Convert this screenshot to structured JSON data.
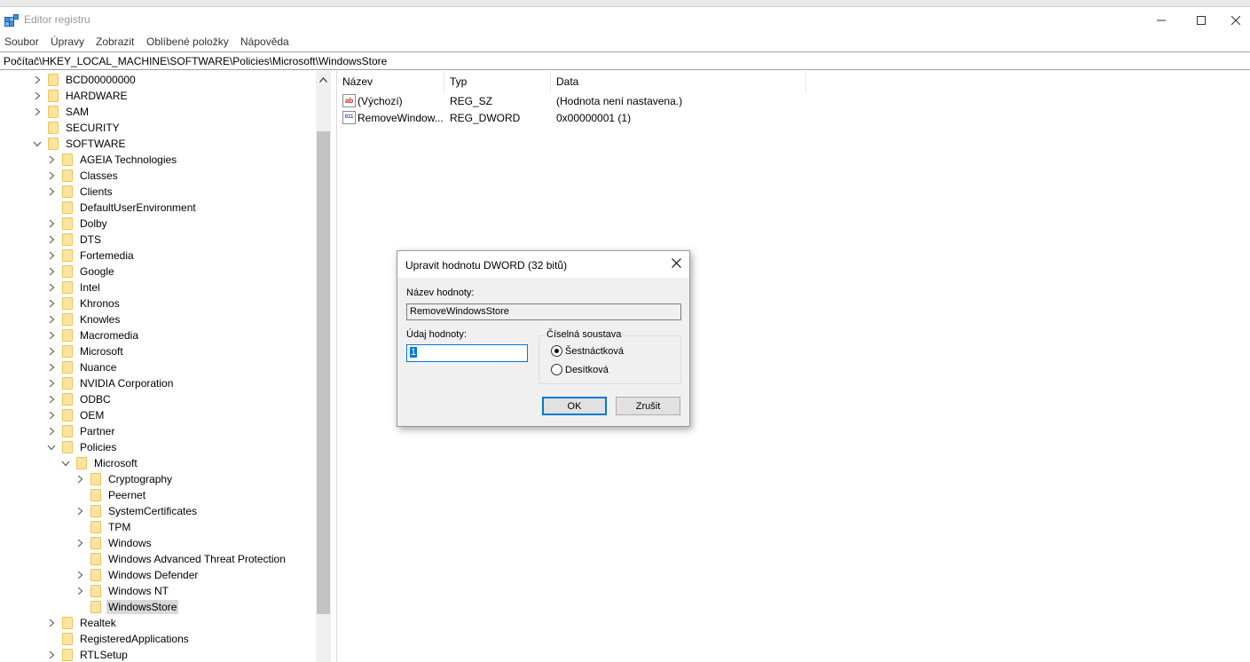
{
  "window": {
    "title": "Editor registru",
    "minimize_glyph": "—",
    "maximize_glyph": "☐",
    "close_glyph": "✕"
  },
  "menu": [
    "Soubor",
    "Úpravy",
    "Zobrazit",
    "Oblíbené položky",
    "Nápověda"
  ],
  "address": "Počítač\\HKEY_LOCAL_MACHINE\\SOFTWARE\\Policies\\Microsoft\\WindowsStore",
  "tree": [
    {
      "label": "BCD00000000",
      "level": 0,
      "expander": "collapsed"
    },
    {
      "label": "HARDWARE",
      "level": 0,
      "expander": "collapsed"
    },
    {
      "label": "SAM",
      "level": 0,
      "expander": "collapsed"
    },
    {
      "label": "SECURITY",
      "level": 0,
      "expander": "none"
    },
    {
      "label": "SOFTWARE",
      "level": 0,
      "expander": "expanded"
    },
    {
      "label": "AGEIA Technologies",
      "level": 1,
      "expander": "collapsed"
    },
    {
      "label": "Classes",
      "level": 1,
      "expander": "collapsed"
    },
    {
      "label": "Clients",
      "level": 1,
      "expander": "collapsed"
    },
    {
      "label": "DefaultUserEnvironment",
      "level": 1,
      "expander": "none"
    },
    {
      "label": "Dolby",
      "level": 1,
      "expander": "collapsed"
    },
    {
      "label": "DTS",
      "level": 1,
      "expander": "collapsed"
    },
    {
      "label": "Fortemedia",
      "level": 1,
      "expander": "collapsed"
    },
    {
      "label": "Google",
      "level": 1,
      "expander": "collapsed"
    },
    {
      "label": "Intel",
      "level": 1,
      "expander": "collapsed"
    },
    {
      "label": "Khronos",
      "level": 1,
      "expander": "collapsed"
    },
    {
      "label": "Knowles",
      "level": 1,
      "expander": "collapsed"
    },
    {
      "label": "Macromedia",
      "level": 1,
      "expander": "collapsed"
    },
    {
      "label": "Microsoft",
      "level": 1,
      "expander": "collapsed"
    },
    {
      "label": "Nuance",
      "level": 1,
      "expander": "collapsed"
    },
    {
      "label": "NVIDIA Corporation",
      "level": 1,
      "expander": "collapsed"
    },
    {
      "label": "ODBC",
      "level": 1,
      "expander": "collapsed"
    },
    {
      "label": "OEM",
      "level": 1,
      "expander": "collapsed"
    },
    {
      "label": "Partner",
      "level": 1,
      "expander": "collapsed"
    },
    {
      "label": "Policies",
      "level": 1,
      "expander": "expanded"
    },
    {
      "label": "Microsoft",
      "level": 2,
      "expander": "expanded"
    },
    {
      "label": "Cryptography",
      "level": 3,
      "expander": "collapsed"
    },
    {
      "label": "Peernet",
      "level": 3,
      "expander": "none"
    },
    {
      "label": "SystemCertificates",
      "level": 3,
      "expander": "collapsed"
    },
    {
      "label": "TPM",
      "level": 3,
      "expander": "none"
    },
    {
      "label": "Windows",
      "level": 3,
      "expander": "collapsed"
    },
    {
      "label": "Windows Advanced Threat Protection",
      "level": 3,
      "expander": "none"
    },
    {
      "label": "Windows Defender",
      "level": 3,
      "expander": "collapsed"
    },
    {
      "label": "Windows NT",
      "level": 3,
      "expander": "collapsed"
    },
    {
      "label": "WindowsStore",
      "level": 3,
      "expander": "none",
      "selected": true
    },
    {
      "label": "Realtek",
      "level": 1,
      "expander": "collapsed"
    },
    {
      "label": "RegisteredApplications",
      "level": 1,
      "expander": "none"
    },
    {
      "label": "RTLSetup",
      "level": 1,
      "expander": "collapsed"
    }
  ],
  "list": {
    "columns": [
      "Název",
      "Typ",
      "Data"
    ],
    "rows": [
      {
        "icon": "string-value-icon",
        "icon_text": "ab",
        "icon_color": "#c42b1c",
        "name": "(Výchozí)",
        "type": "REG_SZ",
        "data": "(Hodnota není nastavena.)"
      },
      {
        "icon": "binary-value-icon",
        "icon_text": "011",
        "icon_color": "#2b5797",
        "name": "RemoveWindow...",
        "type": "REG_DWORD",
        "data": "0x00000001 (1)"
      }
    ]
  },
  "dialog": {
    "title": "Upravit hodnotu DWORD (32 bitů)",
    "name_label": "Název hodnoty:",
    "name_value": "RemoveWindowsStore",
    "data_label": "Údaj hodnoty:",
    "data_value": "1",
    "base_group_label": "Číselná soustava",
    "radio_hex": "Šestnáctková",
    "radio_dec": "Desítková",
    "base_selected": "hex",
    "ok_label": "OK",
    "cancel_label": "Zrušit"
  },
  "colors": {
    "accent": "#0078d7",
    "folder": "#ffe49c",
    "selection": "#d9d9d9"
  }
}
